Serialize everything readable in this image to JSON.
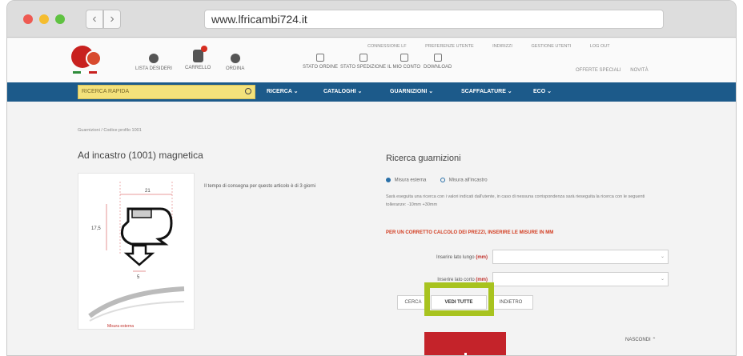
{
  "browser": {
    "url": "www.lfricambi724.it"
  },
  "header": {
    "icons": [
      {
        "label": "LISTA DESIDERI",
        "icon": "heart-icon"
      },
      {
        "label": "CARRELLO",
        "icon": "cart-icon"
      },
      {
        "label": "ORDINA",
        "icon": "order-icon"
      },
      {
        "label": "STATO ORDINE",
        "icon": "order-status-icon"
      },
      {
        "label": "STATO SPEDIZIONE",
        "icon": "truck-icon"
      },
      {
        "label": "IL MIO CONTO",
        "icon": "account-icon"
      },
      {
        "label": "DOWNLOAD",
        "icon": "download-icon"
      }
    ],
    "toplinks": [
      "CONNESSIONE LF",
      "PREFERENZE UTENTE",
      "INDIRIZZI",
      "GESTIONE UTENTI",
      "LOG OUT"
    ],
    "offers": [
      "OFFERTE SPECIALI",
      "NOVITÀ"
    ]
  },
  "menu": {
    "search_placeholder": "RICERCA RAPIDA",
    "items": [
      "RICERCA ⌄",
      "CATALOGHI ⌄",
      "GUARNIZIONI ⌄",
      "SCAFFALATURE ⌄",
      "ECO ⌄"
    ]
  },
  "breadcrumb": "Guarnizioni  /  Codice profilo 1001",
  "product": {
    "title": "Ad incastro (1001) magnetica",
    "delivery": "Il tempo di consegna per questo articolo è di 3 giorni",
    "dims": {
      "width": "21",
      "height": "17,5",
      "base": "5"
    },
    "caption": "Misura esterna"
  },
  "search": {
    "title": "Ricerca guarnizioni",
    "radio_external": "Misura esterna",
    "radio_internal": "Misura all'incastro",
    "description": "Sarà eseguita una ricerca con i valori indicati dall'utente, in caso di nessuna corrispondenza sarà rieseguita la ricerca con le seguenti tolleranze: -10mm +30mm",
    "warning": "PER UN CORRETTO CALCOLO DEI PREZZI, INSERIRE LE MISURE IN MM",
    "long_label": "Inserire lato lungo",
    "short_label": "Inserire lato corto",
    "unit": "(mm)",
    "btn_search": "CERCA",
    "btn_all": "VEDI TUTTE",
    "btn_back": "INDIETRO",
    "hide": "NASCONDI ⌃"
  },
  "colors": {
    "menu": "#1c5a8a",
    "accent_green": "#a8c31f",
    "red": "#c4232a",
    "search_yellow": "#f4e27b"
  }
}
